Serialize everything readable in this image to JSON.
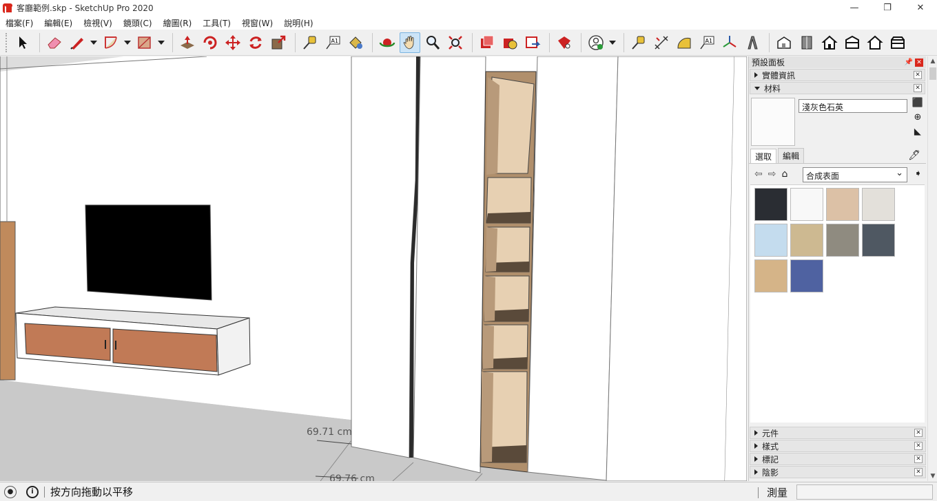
{
  "window": {
    "title": "客廳範例.skp - SketchUp Pro 2020",
    "controls": [
      "—",
      "❐",
      "✕"
    ]
  },
  "menu": [
    "檔案(F)",
    "編輯(E)",
    "檢視(V)",
    "鏡頭(C)",
    "繪圖(R)",
    "工具(T)",
    "視窗(W)",
    "說明(H)"
  ],
  "viewport": {
    "dimensions": [
      "69.71 cm",
      "69.76 cm"
    ]
  },
  "tray": {
    "title": "預設面板",
    "entity_info": "實體資訊",
    "materials": {
      "label": "材料",
      "current_name": "淺灰色石英",
      "tab_select": "選取",
      "tab_edit": "編輯",
      "collection": "合成表面",
      "swatches": [
        "#2a2d33",
        "#f8f8f8",
        "#dcc1a6",
        "#e3e0da",
        "#c4dcee",
        "#cdb991",
        "#8f8b80",
        "#4f5862",
        "#d5b488",
        "#4f62a1"
      ]
    },
    "collapsed_panels": [
      "元件",
      "樣式",
      "標記",
      "陰影"
    ]
  },
  "status": {
    "hint": "按方向拖動以平移",
    "measure_label": "測量",
    "measure_value": ""
  }
}
